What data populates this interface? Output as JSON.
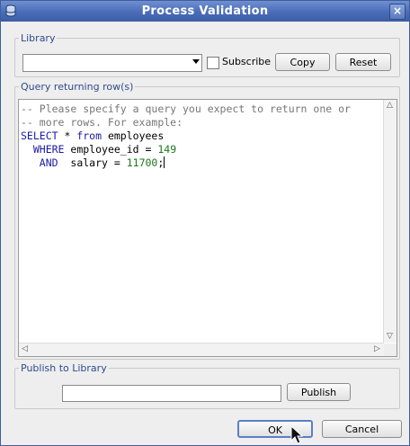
{
  "window": {
    "title": "Process Validation",
    "close_glyph": "×",
    "icon": "database-icon"
  },
  "library": {
    "legend": "Library",
    "dropdown_value": "",
    "subscribe_label": "Subscribe",
    "subscribe_checked": false,
    "copy_label": "Copy",
    "reset_label": "Reset"
  },
  "query": {
    "legend": "Query returning row(s)",
    "comment_1": "-- Please specify a query you expect to return one or",
    "comment_2": "-- more rows. For example:",
    "select_kw": "SELECT",
    "select_rest": " * ",
    "from_kw": "from",
    "table": " employees",
    "where_kw": "WHERE",
    "where_rest": " employee_id = ",
    "where_val": "149",
    "and_kw": "AND",
    "and_rest": "  salary = ",
    "and_val": "11700",
    "and_end": ";"
  },
  "publish": {
    "legend": "Publish to Library",
    "field_value": "",
    "button_label": "Publish"
  },
  "footer": {
    "ok_label": "OK",
    "cancel_label": "Cancel"
  },
  "colors": {
    "titlebar": "#4a6cb8",
    "legend": "#2c4c8c",
    "keyword": "#1a1aa6",
    "number": "#1a7a1a",
    "comment": "#777777"
  }
}
